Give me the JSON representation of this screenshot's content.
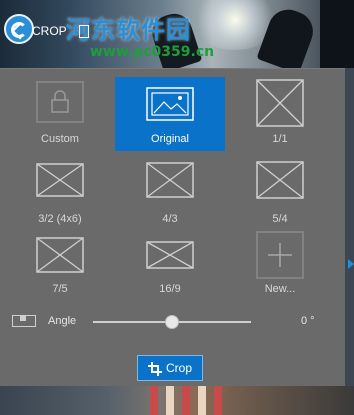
{
  "header": {
    "title": "CROP",
    "watermark_text": "河东软件园",
    "watermark_url": "www.pc0359.cn"
  },
  "crop_options": [
    {
      "label": "Custom",
      "icon": "lock-icon",
      "selected": false,
      "disabled": true
    },
    {
      "label": "Original",
      "icon": "image-icon",
      "selected": true,
      "disabled": false
    },
    {
      "label": "1/1",
      "icon": "ratio-box-icon",
      "selected": false,
      "disabled": false
    },
    {
      "label": "3/2 (4x6)",
      "icon": "ratio-box-icon",
      "selected": false,
      "disabled": false
    },
    {
      "label": "4/3",
      "icon": "ratio-box-icon",
      "selected": false,
      "disabled": false
    },
    {
      "label": "5/4",
      "icon": "ratio-box-icon",
      "selected": false,
      "disabled": false
    },
    {
      "label": "7/5",
      "icon": "ratio-box-icon",
      "selected": false,
      "disabled": false
    },
    {
      "label": "16/9",
      "icon": "ratio-box-icon",
      "selected": false,
      "disabled": false
    },
    {
      "label": "New...",
      "icon": "plus-icon",
      "selected": false,
      "disabled": false
    }
  ],
  "angle": {
    "label": "Angle",
    "value_text": "0 °",
    "slider_fraction": 0.5
  },
  "crop_button": {
    "label": "Crop"
  },
  "colors": {
    "accent": "#0b72c9",
    "panel": "#6a6a6a",
    "text": "#d8d8d8"
  }
}
